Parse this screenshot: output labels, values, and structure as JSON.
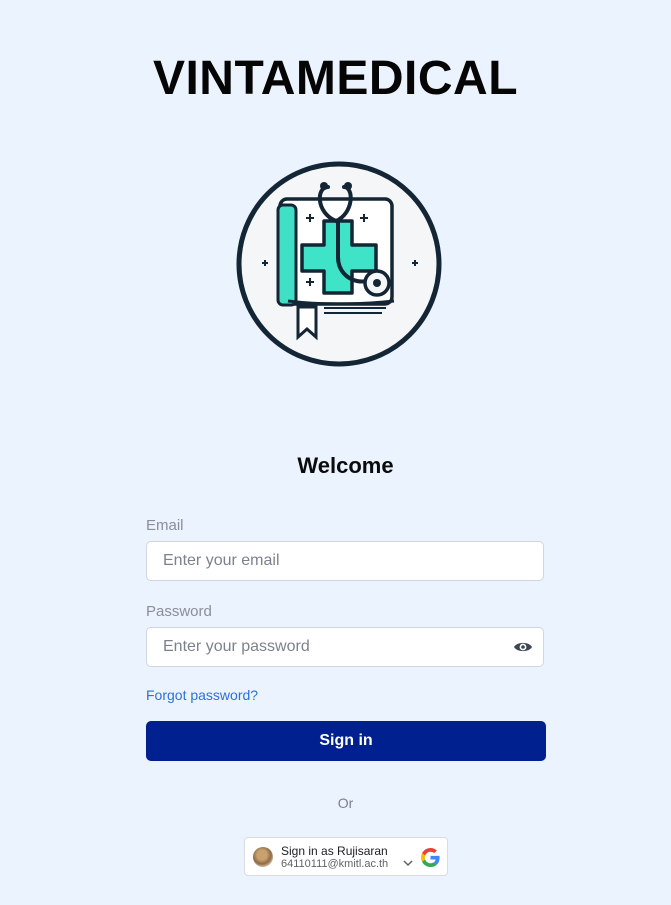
{
  "app": {
    "title": "VINTAMEDICAL"
  },
  "login": {
    "heading": "Welcome",
    "email_label": "Email",
    "email_placeholder": "Enter your email",
    "password_label": "Password",
    "password_placeholder": "Enter your password",
    "forgot_link": "Forgot password?",
    "signin_button": "Sign in",
    "divider_text": "Or"
  },
  "google_signin": {
    "name_line": "Sign in as Rujisaran",
    "email_line": "64110111@kmitl.ac.th"
  },
  "colors": {
    "background": "#EBF3FE",
    "primary_button": "#00208F",
    "link": "#2F6FDC",
    "logo_accent": "#3FE3C8"
  },
  "icons": [
    "medical-book-logo",
    "eye-icon",
    "chevron-down-icon",
    "google-g-icon",
    "avatar"
  ]
}
